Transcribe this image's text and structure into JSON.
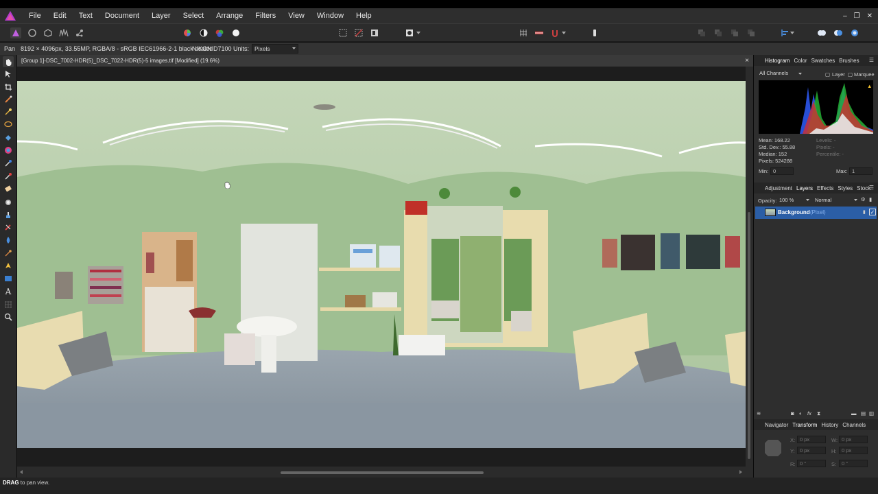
{
  "menu": {
    "items": [
      "File",
      "Edit",
      "Text",
      "Document",
      "Layer",
      "Select",
      "Arrange",
      "Filters",
      "View",
      "Window",
      "Help"
    ],
    "window_controls": [
      "–",
      "❐",
      "✕"
    ]
  },
  "context_bar": {
    "tool": "Pan",
    "info": "8192 × 4096px, 33.55MP, RGBA/8 - sRGB IEC61966-2-1 black scaled",
    "camera": "NIKON D7100",
    "units_label": "Units:",
    "units_value": "Pixels"
  },
  "document": {
    "title": "[Group 1]-DSC_7002-HDR(5)_DSC_7022-HDR(5)-5 images.tif [Modified] (19.6%)",
    "close": "×"
  },
  "status": {
    "action": "DRAG",
    "hint": "to pan view."
  },
  "histogram_panel": {
    "tabs": [
      "Histogram",
      "Color",
      "Swatches",
      "Brushes"
    ],
    "channel": "All Channels",
    "layer_label": "Layer",
    "marquee_label": "Marquee",
    "stats_left": [
      "Mean: 168.22",
      "Std. Dev.: 55.88",
      "Median: 152",
      "Pixels: 524288"
    ],
    "stats_right": [
      "Levels: -",
      "Pixels: -",
      "Percentile: -"
    ],
    "min_label": "Min:",
    "min_value": "0",
    "max_label": "Max:",
    "max_value": "1"
  },
  "layers_panel": {
    "tabs": [
      "Adjustment",
      "Layers",
      "Effects",
      "Styles",
      "Stock"
    ],
    "opacity_label": "Opacity:",
    "opacity_value": "100 %",
    "blend_mode": "Normal",
    "layer_name": "Background",
    "layer_type": "(Pixel)"
  },
  "transform_panel": {
    "tabs": [
      "Navigator",
      "Transform",
      "History",
      "Channels"
    ],
    "x_label": "X:",
    "x_value": "0 px",
    "y_label": "Y:",
    "y_value": "0 px",
    "w_label": "W:",
    "w_value": "0 px",
    "h_label": "H:",
    "h_value": "0 px",
    "r_label": "R:",
    "r_value": "0 °",
    "s_label": "S:",
    "s_value": "0 °"
  },
  "colors": {
    "accent_blue": "#2d6fc4",
    "layer_selected": "#2b5ea6",
    "wall_green": "#9fbf92",
    "floor_gray": "#8f9aa5"
  }
}
